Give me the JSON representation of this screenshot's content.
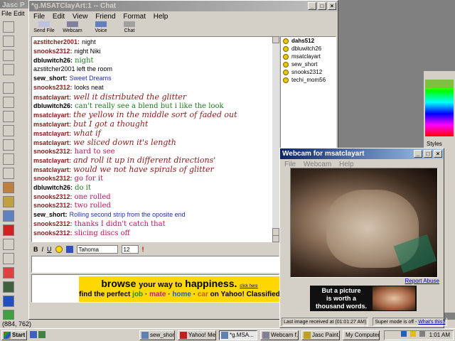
{
  "background_app": {
    "title": "Jasc P",
    "menu": [
      "File",
      "Edit"
    ],
    "status_coords": "(884, 762)",
    "styles_label": "Styles"
  },
  "chat": {
    "title": "*g.MSATClayArt:1 -- Chat",
    "menu": [
      "File",
      "Edit",
      "View",
      "Friend",
      "Format",
      "Help"
    ],
    "toolbar": [
      "Send File",
      "Webcam",
      "Voice",
      "Chat"
    ],
    "messages": [
      {
        "user": "azstitcher2001:",
        "text": "night",
        "style": "plain"
      },
      {
        "user": "snooks2312:",
        "text": "night Niki",
        "style": "plain"
      },
      {
        "user": "dbluwitch26:",
        "text": "night",
        "style": "green"
      },
      {
        "user": "",
        "text": "azstitcher2001 left the room",
        "style": "system"
      },
      {
        "user": "sew_short:",
        "text": "Sweet Dreams",
        "style": "blue"
      },
      {
        "user": "snooks2312:",
        "text": "looks neat",
        "style": "plain"
      },
      {
        "user": "msatclayart:",
        "text": "well it distributed the glitter",
        "style": "script"
      },
      {
        "user": "dbluwitch26:",
        "text": "can't really see a blend but i like the look",
        "style": "green"
      },
      {
        "user": "msatclayart:",
        "text": "the yellow in the middle sort of faded out",
        "style": "script"
      },
      {
        "user": "msatclayart:",
        "text": "but I got a thought",
        "style": "script"
      },
      {
        "user": "msatclayart:",
        "text": "what if",
        "style": "script"
      },
      {
        "user": "msatclayart:",
        "text": "we sliced down it's length",
        "style": "script"
      },
      {
        "user": "snooks2312:",
        "text": "hard to see",
        "style": "pink"
      },
      {
        "user": "msatclayart:",
        "text": "and roll it up in different directions'",
        "style": "script"
      },
      {
        "user": "msatclayart:",
        "text": "would we not have spirals of glitter",
        "style": "script"
      },
      {
        "user": "snooks2312:",
        "text": "go for it",
        "style": "pink"
      },
      {
        "user": "dbluwitch26:",
        "text": "do it",
        "style": "green"
      },
      {
        "user": "snooks2312:",
        "text": "one rolled",
        "style": "pink"
      },
      {
        "user": "snooks2312:",
        "text": "two rolled",
        "style": "pink"
      },
      {
        "user": "sew_short:",
        "text": "Rolling second strip from the oposite end",
        "style": "blue"
      },
      {
        "user": "snooks2312:",
        "text": "thanks I didn't catch that",
        "style": "pink"
      },
      {
        "user": "snooks2312:",
        "text": "slicing discs off",
        "style": "pink"
      }
    ],
    "users": [
      "dahs512",
      "dbluwitch26",
      "msatclayart",
      "sew_short",
      "snooks2312",
      "techi_mom56"
    ],
    "format": {
      "bold": "B",
      "italic": "I",
      "underline": "U",
      "font": "Tahoma",
      "size": "12"
    },
    "ad": {
      "line1_a": "browse",
      "line1_b": "your way to",
      "line1_c": "happiness.",
      "click_here": "click here",
      "line2_a": "find the perfect",
      "line2_job": "job",
      "line2_mate": "mate",
      "line2_home": "home",
      "line2_car": "car",
      "line2_b": "on Yahoo! Classified"
    }
  },
  "webcam": {
    "title": "Webcam for msatclayart",
    "menu": [
      "File",
      "Webcam",
      "Help"
    ],
    "report_abuse": "Report Abuse",
    "ad_text_1": "But a picture",
    "ad_text_2": "is worth a",
    "ad_text_3": "thousand words.",
    "status_left": "Last image received at (01:01:27 AM)",
    "status_right_a": "Super mode is off -",
    "status_right_b": "What's this?"
  },
  "taskbar": {
    "start": "Start",
    "tasks": [
      "sew_short'...",
      "Yahoo! Me...",
      "*g.MSA...",
      "Webcam f...",
      "Jasc Paint..."
    ],
    "my_computer": "My Computer",
    "clock": "1:01 AM"
  },
  "colors": {
    "title_active": "#0a246a",
    "script_text": "#8b1a1a",
    "green_text": "#1a7a1a",
    "blue_text": "#2030a0",
    "pink_text": "#c0105a",
    "ad_yellow": "#ffd800"
  }
}
